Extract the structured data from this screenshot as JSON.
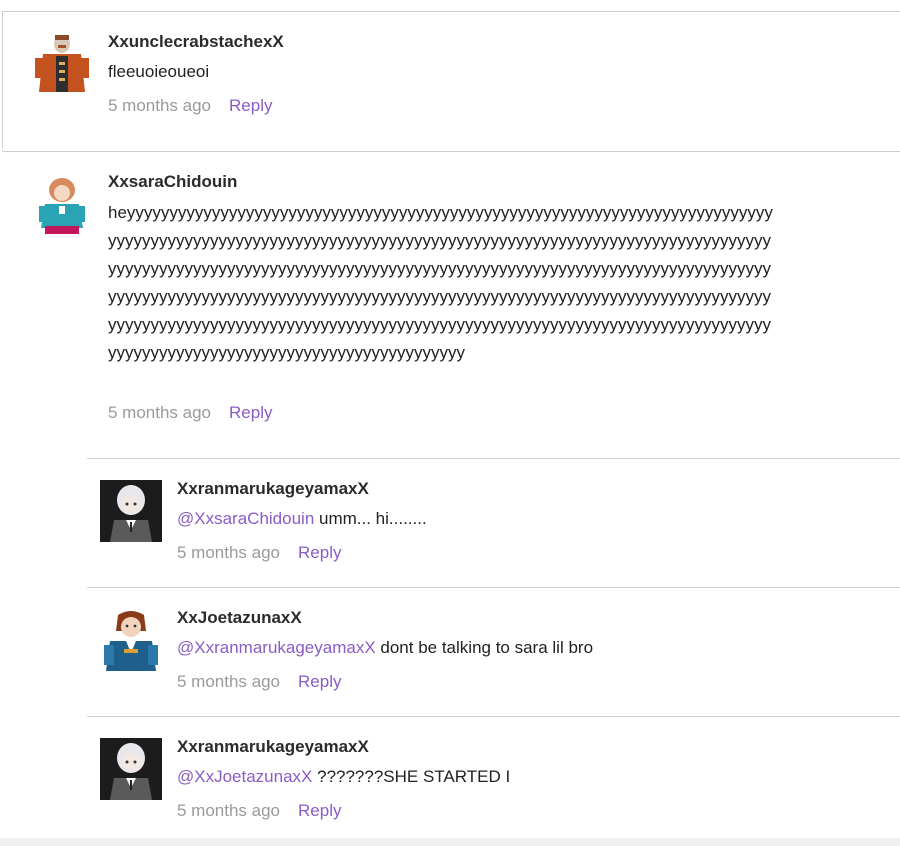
{
  "comments": [
    {
      "username": "XxunclecrabstachexX",
      "text": "fleeuoieoueoi",
      "time": "5 months ago",
      "reply_label": "Reply"
    },
    {
      "username": "XxsaraChidouin",
      "text": "heyyyyyyyyyyyyyyyyyyyyyyyyyyyyyyyyyyyyyyyyyyyyyyyyyyyyyyyyyyyyyyyyyyyyyyyyyyyyyyyyyyyyyyyyyyyyyyyyyyyyyyyyyyyyyyyyyyyyyyyyyyyyyyyyyyyyyyyyyyyyyyyyyyyyyyyyyyyyyyyyyyyyyyyyyyyyyyyyyyyyyyyyyyyyyyyyyyyyyyyyyyyyyyyyyyyyyyyyyyyyyyyyyyyyyyyyyyyyyyyyyyyyyyyyyyyyyyyyyyyyyyyyyyyyyyyyyyyyyyyyyyyyyyyyyyyyyyyyyyyyyyyyyyyyyyyyyyyyyyyyyyyyyyyyyyyyyyyyyyyyyyyyyyyyyyyyyyyyyyyyyyyyyyyyyyyyyyyyyyyyyyyyyyyyyyyyyyyyyyyyyyyyyyyyyyyyyyyyyyyyyyyyyyyyyy",
      "time": "5 months ago",
      "reply_label": "Reply"
    }
  ],
  "replies": [
    {
      "username": "XxranmarukageyamaxX",
      "mention": "@XxsaraChidouin",
      "text": " umm... hi........",
      "time": "5 months ago",
      "reply_label": "Reply"
    },
    {
      "username": "XxJoetazunaxX",
      "mention": "@XxranmarukageyamaxX",
      "text": " dont be talking to sara lil bro",
      "time": "5 months ago",
      "reply_label": "Reply"
    },
    {
      "username": "XxranmarukageyamaxX",
      "mention": "@XxJoetazunaxX",
      "text": " ???????SHE STARTED I",
      "time": "5 months ago",
      "reply_label": "Reply"
    }
  ],
  "colors": {
    "accent": "#8a5cc7",
    "meta": "#9a9a9a",
    "divider": "#d0d0d0"
  },
  "icons": [
    "uncle-crab-avatar-icon",
    "sara-avatar-icon",
    "ranmaru-avatar-icon",
    "joe-avatar-icon"
  ]
}
